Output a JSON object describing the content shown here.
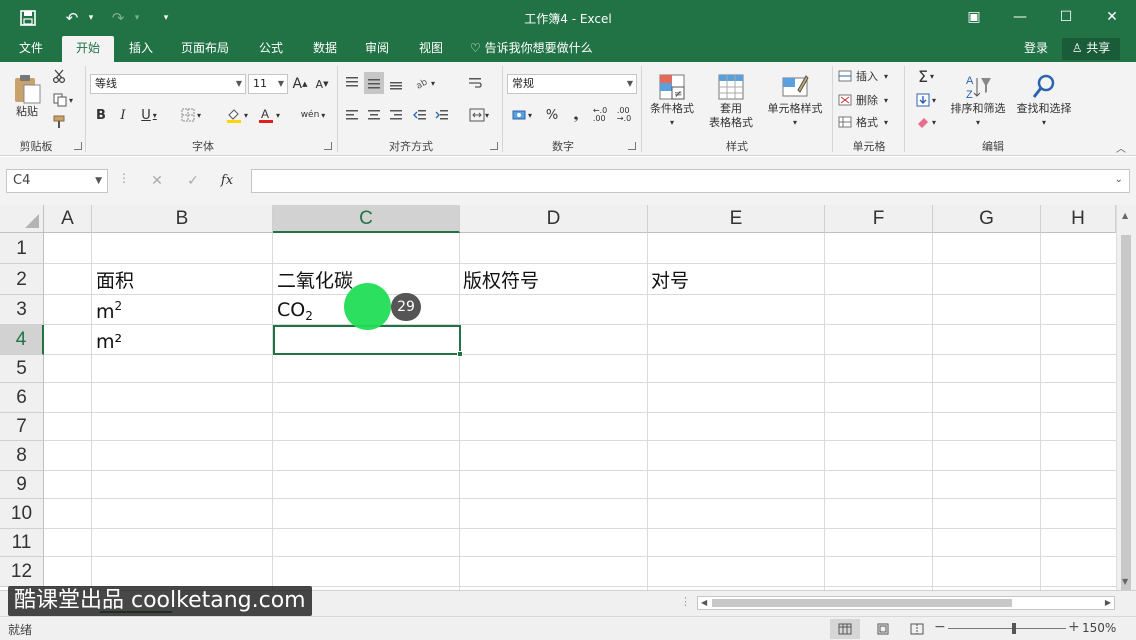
{
  "window": {
    "title": "工作簿4 - Excel",
    "save_glyph": "▪",
    "undo_glyph": "↶",
    "redo_glyph": "↷",
    "qa_menu_glyph": "▾",
    "ribbon_options_glyph": "▣",
    "minimize_glyph": "—",
    "maximize_glyph": "☐",
    "close_glyph": "✕"
  },
  "tabs": [
    "文件",
    "开始",
    "插入",
    "页面布局",
    "公式",
    "数据",
    "审阅",
    "视图"
  ],
  "active_tab": "开始",
  "tell_me": "♡ 告诉我你想要做什么",
  "login": "登录",
  "share": "♙ 共享",
  "ribbon": {
    "clipboard": {
      "label": "剪贴板",
      "paste": "粘贴"
    },
    "font": {
      "label": "字体",
      "font_name": "等线",
      "font_size": "11",
      "grow": "A",
      "shrink": "A",
      "bold": "B",
      "italic": "I",
      "underline": "U",
      "phonetic": "wén"
    },
    "alignment": {
      "label": "对齐方式"
    },
    "number": {
      "label": "数字",
      "format": "常规",
      "percent": "%"
    },
    "styles": {
      "label": "样式",
      "conditional": "条件格式",
      "as_table_line1": "套用",
      "as_table_line2": "表格格式",
      "cell_styles": "单元格样式"
    },
    "cells": {
      "label": "单元格",
      "insert": "插入",
      "delete": "删除",
      "format": "格式"
    },
    "editing": {
      "label": "编辑",
      "sort_filter": "排序和筛选",
      "find_select": "查找和选择"
    }
  },
  "formula_bar": {
    "name_box": "C4",
    "cancel": "✕",
    "enter": "✓",
    "fx": "fx",
    "value": ""
  },
  "columns": [
    "A",
    "B",
    "C",
    "D",
    "E",
    "F",
    "G",
    "H"
  ],
  "rows": [
    "1",
    "2",
    "3",
    "4",
    "5",
    "6",
    "7",
    "8",
    "9",
    "10",
    "11",
    "12"
  ],
  "selected_cell": "C4",
  "cells": {
    "B2": "面积",
    "C2": "二氧化碳",
    "D2": "版权符号",
    "E2": "对号",
    "B3_base": "m",
    "B3_sup": "2",
    "C3_base": "CO",
    "C3_sub": "2",
    "B4": "m²"
  },
  "click_badge": "29",
  "watermark": "酷课堂出品 coolketang.com",
  "status": {
    "ready": "就绪",
    "zoom": "150%",
    "zoom_minus": "−",
    "zoom_plus": "+"
  }
}
